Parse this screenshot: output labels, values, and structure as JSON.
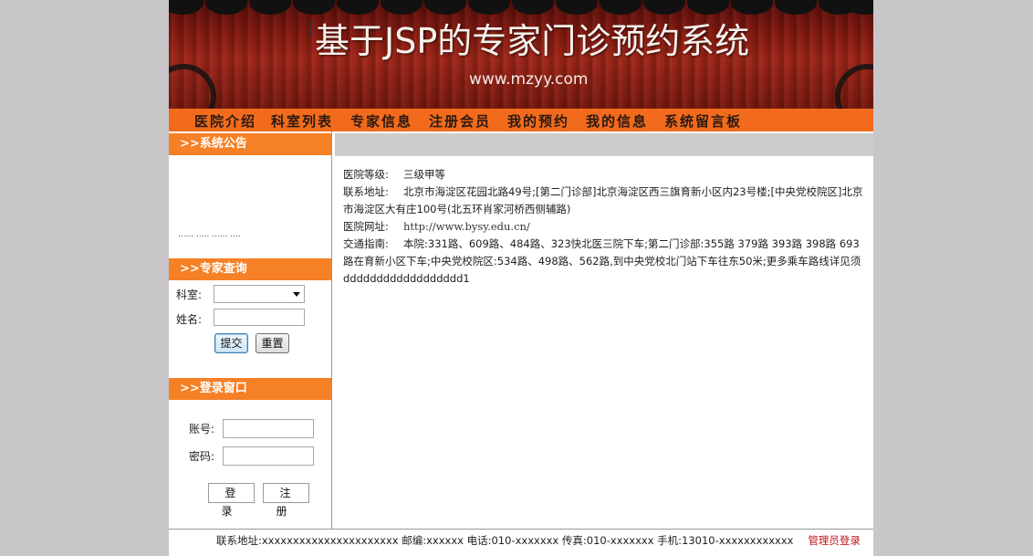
{
  "banner": {
    "title": "基于JSP的专家门诊预约系统",
    "url": "www.mzyy.com"
  },
  "nav": {
    "items": [
      "医院介绍",
      "科室列表",
      "专家信息",
      "注册会员",
      "我的预约",
      "我的信息",
      "系统留言板"
    ]
  },
  "sidebar": {
    "notice": {
      "title": ">>系统公告",
      "scroll_text": "...... ..... ...... ...."
    },
    "expert_search": {
      "title": ">>专家查询",
      "department_label": "科室:",
      "department_value": "",
      "name_label": "姓名:",
      "name_value": "",
      "submit_label": "提交",
      "reset_label": "重置"
    },
    "login": {
      "title": ">>登录窗口",
      "account_label": "账号:",
      "account_value": "",
      "password_label": "密码:",
      "password_value": "",
      "login_label": "登录",
      "register_label": "注册"
    }
  },
  "main": {
    "rows": [
      {
        "label": "医院等级:",
        "value": "三级甲等"
      },
      {
        "label": "联系地址:",
        "value": "北京市海淀区花园北路49号;[第二门诊部]北京海淀区西三旗育新小区内23号楼;[中央党校院区]北京市海淀区大有庄100号(北五环肖家河桥西侧辅路)"
      },
      {
        "label": "医院网址:",
        "value": "http://www.bysy.edu.cn/"
      },
      {
        "label": "交通指南:",
        "value": "本院:331路、609路、484路、323快北医三院下车;第二门诊部:355路 379路 393路 398路 693路在育新小区下车;中央党校院区:534路、498路、562路,到中央党校北门站下车往东50米;更多乘车路线详见须dddddddddddddddddd1"
      }
    ]
  },
  "footer": {
    "contact": "联系地址:xxxxxxxxxxxxxxxxxxxxxx   邮编:xxxxxx 电话:010-xxxxxxx   传真:010-xxxxxxx   手机:13010-xxxxxxxxxxxx",
    "admin_login": "管理员登录"
  }
}
